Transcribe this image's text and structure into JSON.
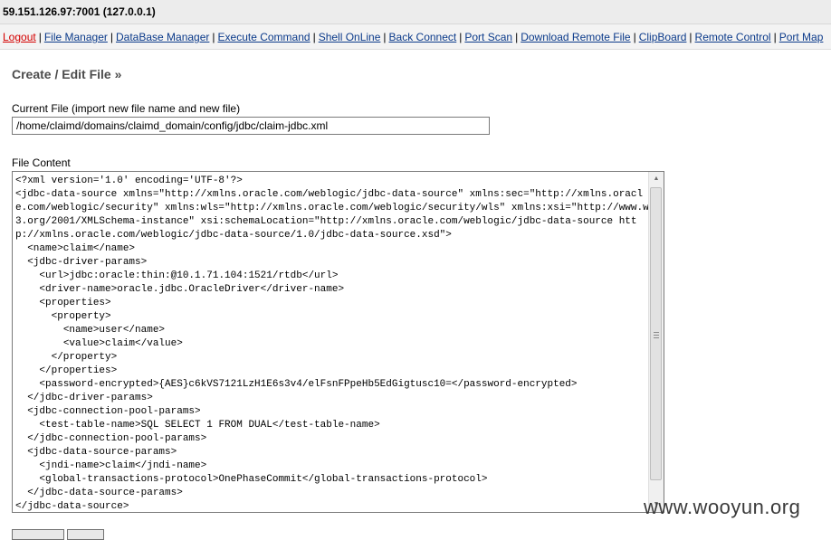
{
  "header": {
    "host": "59.151.126.97:7001 (127.0.0.1)"
  },
  "nav": {
    "items": [
      "Logout",
      "File Manager",
      "DataBase Manager",
      "Execute Command",
      "Shell OnLine",
      "Back Connect",
      "Port Scan",
      "Download Remote File",
      "ClipBoard",
      "Remote Control",
      "Port Map"
    ],
    "separator": "|"
  },
  "page": {
    "title": "Create / Edit File »",
    "current_file_label": "Current File (import new file name and new file)",
    "current_file_value": "/home/claimd/domains/claimd_domain/config/jdbc/claim-jdbc.xml",
    "file_content_label": "File Content",
    "file_content": "<?xml version='1.0' encoding='UTF-8'?>\n<jdbc-data-source xmlns=\"http://xmlns.oracle.com/weblogic/jdbc-data-source\" xmlns:sec=\"http://xmlns.oracle.com/weblogic/security\" xmlns:wls=\"http://xmlns.oracle.com/weblogic/security/wls\" xmlns:xsi=\"http://www.w3.org/2001/XMLSchema-instance\" xsi:schemaLocation=\"http://xmlns.oracle.com/weblogic/jdbc-data-source http://xmlns.oracle.com/weblogic/jdbc-data-source/1.0/jdbc-data-source.xsd\">\n  <name>claim</name>\n  <jdbc-driver-params>\n    <url>jdbc:oracle:thin:@10.1.71.104:1521/rtdb</url>\n    <driver-name>oracle.jdbc.OracleDriver</driver-name>\n    <properties>\n      <property>\n        <name>user</name>\n        <value>claim</value>\n      </property>\n    </properties>\n    <password-encrypted>{AES}c6kVS7121LzH1E6s3v4/elFsnFPpeHb5EdGigtusc10=</password-encrypted>\n  </jdbc-driver-params>\n  <jdbc-connection-pool-params>\n    <test-table-name>SQL SELECT 1 FROM DUAL</test-table-name>\n  </jdbc-connection-pool-params>\n  <jdbc-data-source-params>\n    <jndi-name>claim</jndi-name>\n    <global-transactions-protocol>OnePhaseCommit</global-transactions-protocol>\n  </jdbc-data-source-params>\n</jdbc-data-source>"
  },
  "watermark": "www.wooyun.org",
  "colors": {
    "logout": "#d40000",
    "link": "#0b3a8a",
    "title": "#4c4c4c",
    "topbar_bg": "#ececec"
  }
}
